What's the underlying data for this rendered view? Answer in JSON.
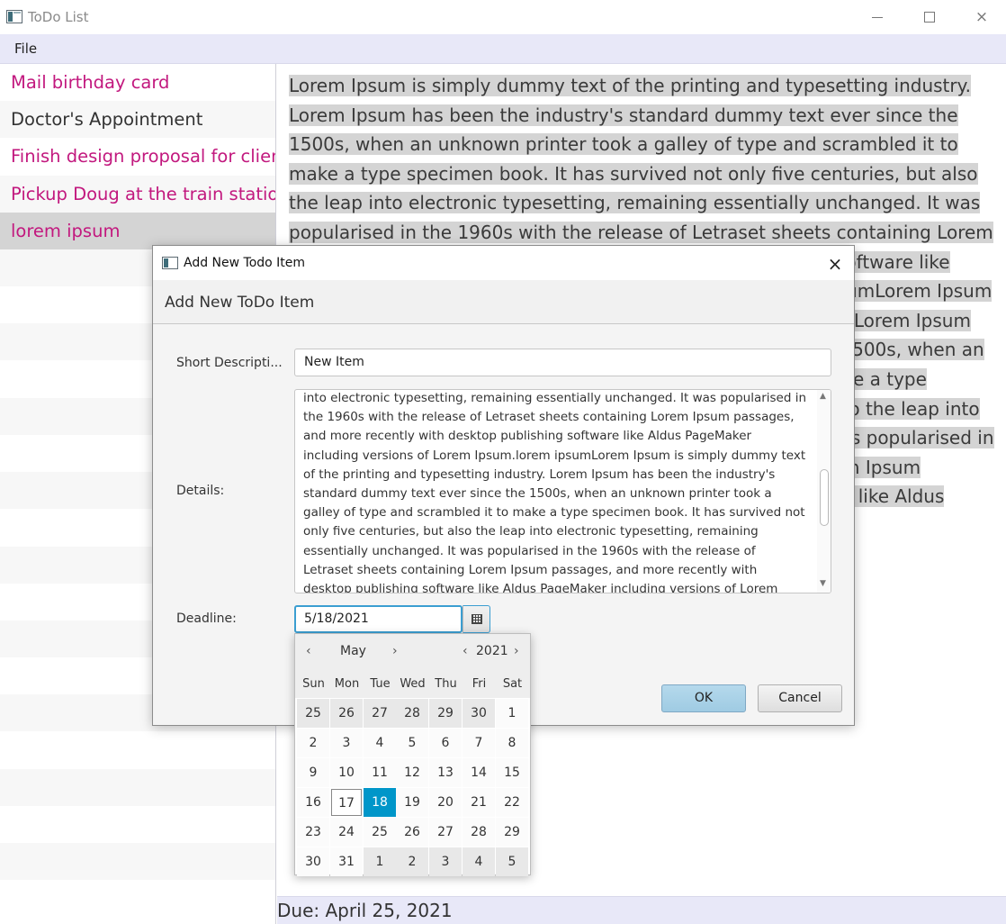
{
  "window": {
    "title": "ToDo List",
    "controls": {
      "minimize": "minimize",
      "maximize": "maximize",
      "close": "×"
    }
  },
  "menu": {
    "file": "File"
  },
  "todo_items": [
    {
      "label": "Mail birthday card",
      "color": "#c2187e"
    },
    {
      "label": "Doctor's Appointment",
      "color": "#333333"
    },
    {
      "label": "Finish design proposal for client",
      "color": "#c2187e"
    },
    {
      "label": "Pickup Doug at the train station",
      "color": "#c2187e"
    },
    {
      "label": "lorem ipsum",
      "color": "#c2187e",
      "selected": true
    }
  ],
  "details_text": "Lorem Ipsum is simply dummy text of the printing and typesetting industry. Lorem Ipsum has been the industry's standard dummy text ever since the 1500s, when an unknown printer took a galley of type and scrambled it to make a type specimen book. It has survived not only five centuries, but also the leap into electronic typesetting, remaining essentially unchanged. It was popularised in the 1960s with the release of Letraset sheets containing Lorem Ipsum passages, and more recently with desktop publishing software like Aldus PageMaker including versions of Lorem Ipsum.lorem ipsumLorem Ipsum is simply dummy text of the printing and typesetting industry. Lorem Ipsum has been the industry's standard dummy text ever since the 1500s, when an unknown printer took a galley of type and scrambled it to make a type specimen book. It has survived not only five centuries, but also the leap into electronic typesetting, remaining essentially unchanged. It was popularised in the 1960s with the release of Letraset sheets containing Lorem Ipsum passages, and more recently with desktop publishing software like Aldus PageMaker including versions of Lorem Ipsum.lorem ipsum",
  "due": "Due: April 25, 2021",
  "dialog": {
    "window_title": "Add New Todo Item",
    "close": "×",
    "header": "Add New ToDo Item",
    "short_label": "Short Descripti...",
    "short_value": "New Item",
    "details_label": "Details:",
    "details_visible_text": "into electronic typesetting, remaining essentially unchanged. It was popularised in the 1960s with the release of Letraset sheets containing Lorem Ipsum passages, and more recently with desktop publishing software like Aldus PageMaker including versions of Lorem Ipsum.lorem ipsumLorem Ipsum is simply dummy text of the printing and typesetting industry. Lorem Ipsum has been the industry's standard dummy text ever since the 1500s, when an unknown printer took a galley of type and scrambled it to make a type specimen book. It has survived not only five centuries, but also the leap into electronic typesetting, remaining essentially unchanged. It was popularised in the 1960s with the release of Letraset sheets containing Lorem Ipsum passages, and more recently with desktop publishing software like Aldus PageMaker including versions of Lorem Ipsum.lorem",
    "deadline_label": "Deadline:",
    "deadline_value": "5/18/2021",
    "ok": "OK",
    "cancel": "Cancel"
  },
  "datepicker": {
    "prev": "‹",
    "next": "›",
    "month": "May",
    "year": "2021",
    "weekdays": [
      "Sun",
      "Mon",
      "Tue",
      "Wed",
      "Thu",
      "Fri",
      "Sat"
    ],
    "weeks": [
      [
        25,
        26,
        27,
        28,
        29,
        30,
        1
      ],
      [
        2,
        3,
        4,
        5,
        6,
        7,
        8
      ],
      [
        9,
        10,
        11,
        12,
        13,
        14,
        15
      ],
      [
        16,
        17,
        18,
        19,
        20,
        21,
        22
      ],
      [
        23,
        24,
        25,
        26,
        27,
        28,
        29
      ],
      [
        30,
        31,
        1,
        2,
        3,
        4,
        5
      ]
    ],
    "today": 17,
    "selected": 18,
    "selected_color": "#0096c9"
  }
}
